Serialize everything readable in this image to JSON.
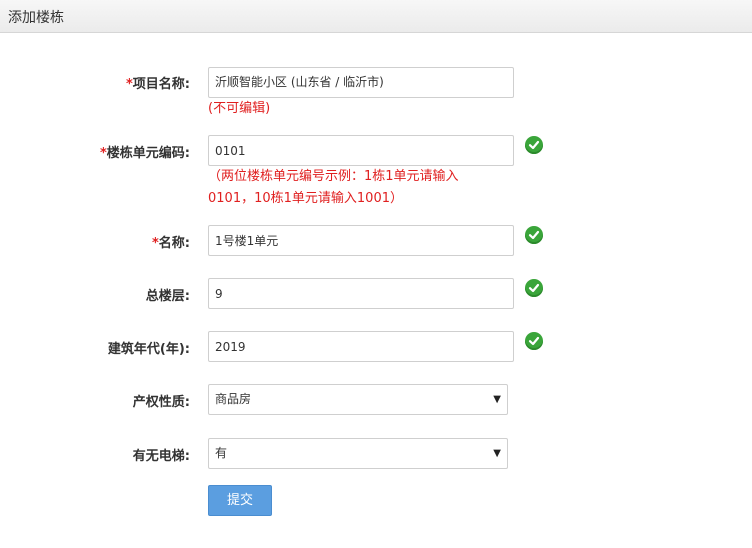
{
  "header": {
    "title": "添加楼栋"
  },
  "form": {
    "required_mark": "*",
    "project": {
      "label": "项目名称:",
      "value": "沂顺智能小区 (山东省 / 临沂市)",
      "note": "(不可编辑)"
    },
    "unit_code": {
      "label": "楼栋单元编码:",
      "value": "0101",
      "hint_line1": "（两位楼栋单元编号示例：1栋1单元请输入",
      "hint_line2": "0101，10栋1单元请输入1001）"
    },
    "name": {
      "label": "名称:",
      "value": "1号楼1单元"
    },
    "total_floors": {
      "label": "总楼层:",
      "value": "9"
    },
    "build_year": {
      "label": "建筑年代(年):",
      "value": "2019"
    },
    "property_type": {
      "label": "产权性质:",
      "selected": "商品房"
    },
    "elevator": {
      "label": "有无电梯:",
      "selected": "有"
    },
    "submit_label": "提交"
  },
  "colors": {
    "required": "#e02020",
    "valid_check": "#3aa53a",
    "submit_bg": "#5b9ee0"
  },
  "icons": {
    "valid": "check-circle-icon",
    "dropdown": "caret-down-icon"
  }
}
